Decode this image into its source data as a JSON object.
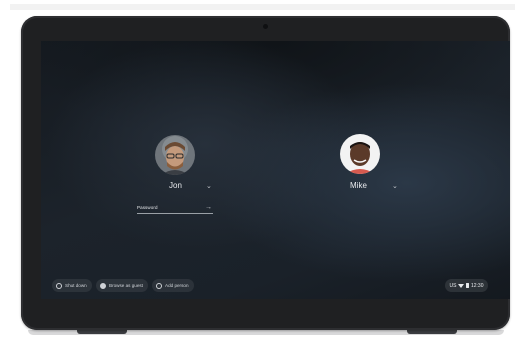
{
  "users": [
    {
      "name": "Jon",
      "avatar_icon": "user-avatar-jon"
    },
    {
      "name": "Mike",
      "avatar_icon": "user-avatar-mike"
    }
  ],
  "password": {
    "placeholder": "Password",
    "submit_icon": "arrow-right-icon"
  },
  "shelf": {
    "shut_down": "Shut down",
    "browse_as_guest": "Browse as guest",
    "add_person": "Add person"
  },
  "tray": {
    "locale": "US",
    "time": "12:30"
  },
  "colors": {
    "screen_bg": "#1a2129",
    "text": "#e8eaed",
    "bezel": "#1f2022"
  }
}
